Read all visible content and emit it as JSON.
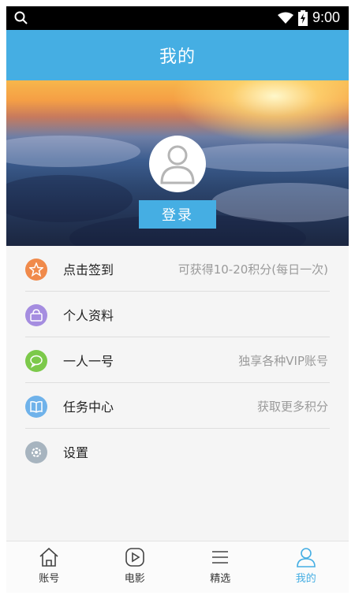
{
  "statusbar": {
    "time": "9:00"
  },
  "appbar": {
    "title": "我的"
  },
  "profile": {
    "login_label": "登录"
  },
  "menu": [
    {
      "label": "点击签到",
      "hint": "可获得10-20积分(每日一次)",
      "icon": "star-icon",
      "color": "#f08a4b"
    },
    {
      "label": "个人资料",
      "hint": "",
      "icon": "bag-icon",
      "color": "#a58de0"
    },
    {
      "label": "一人一号",
      "hint": "独享各种VIP账号",
      "icon": "chat-icon",
      "color": "#7cc94a"
    },
    {
      "label": "任务中心",
      "hint": "获取更多积分",
      "icon": "book-icon",
      "color": "#6fb2ea"
    },
    {
      "label": "设置",
      "hint": "",
      "icon": "gear-icon",
      "color": "#a7b4bf"
    }
  ],
  "tabs": [
    {
      "label": "账号",
      "icon": "home-icon",
      "active": false
    },
    {
      "label": "电影",
      "icon": "play-icon",
      "active": false
    },
    {
      "label": "精选",
      "icon": "list-icon",
      "active": false
    },
    {
      "label": "我的",
      "icon": "user-icon",
      "active": true
    }
  ],
  "colors": {
    "accent": "#45aee3"
  }
}
